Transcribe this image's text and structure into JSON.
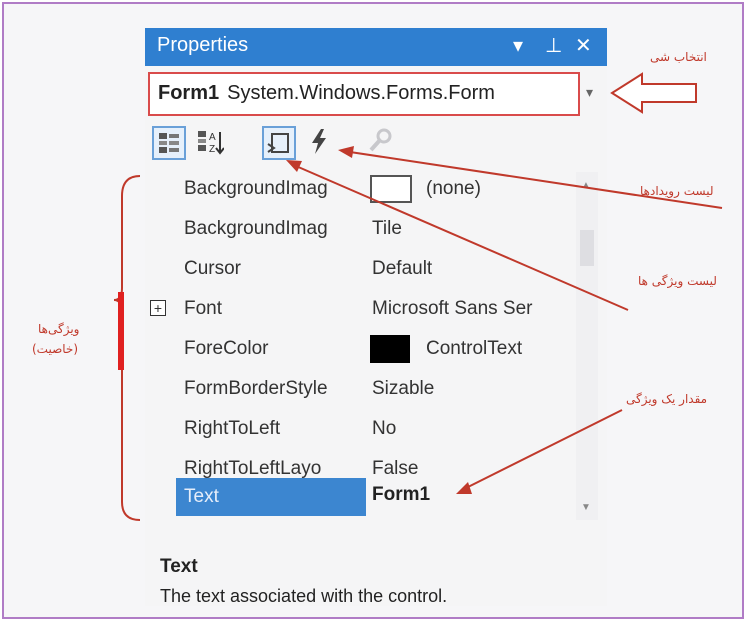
{
  "window": {
    "title": "Properties",
    "controls": [
      "▾",
      "⊥",
      "✕"
    ]
  },
  "object_selector": {
    "name": "Form1",
    "type": "System.Windows.Forms.Form"
  },
  "toolbar": {
    "buttons": [
      "categorized-icon",
      "alphabetical-icon",
      "properties-icon",
      "events-icon",
      "property-pages-icon"
    ]
  },
  "properties": [
    {
      "name": "BackgroundImag",
      "value": "(none)"
    },
    {
      "name": "BackgroundImag",
      "value": "Tile"
    },
    {
      "name": "Cursor",
      "value": "Default"
    },
    {
      "name": "Font",
      "value": "Microsoft Sans Ser"
    },
    {
      "name": "ForeColor",
      "value": "ControlText"
    },
    {
      "name": "FormBorderStyle",
      "value": "Sizable"
    },
    {
      "name": "RightToLeft",
      "value": "No"
    },
    {
      "name": "RightToLeftLayo",
      "value": "False"
    },
    {
      "name": "Text",
      "value": "Form1"
    }
  ],
  "description": {
    "title": "Text",
    "text": "The text associated with the control."
  },
  "annotations": {
    "object_select": "انتخاب شی",
    "events_list": "لیست رویدادها",
    "properties_list": "لیست ویژگی ها",
    "property_value": "مقدار یک ویژگی",
    "properties_line1": "ویژگی‌ها",
    "properties_line2": "(خاصیت)"
  },
  "colors": {
    "titlebar": "#2f7fd0",
    "annotation": "#c0392b",
    "frame": "#b07cc6",
    "selection": "#3c86d0"
  }
}
